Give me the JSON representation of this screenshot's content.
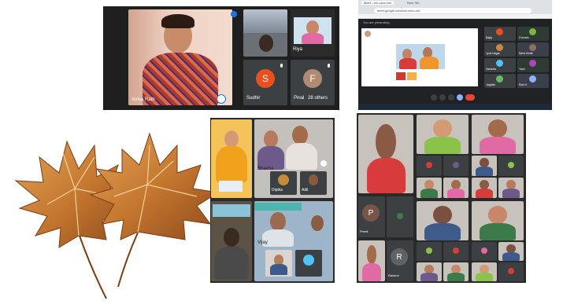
{
  "panel1": {
    "presenter_name": "Amsa Rath",
    "tiles": [
      {
        "name": "Riya"
      },
      {
        "name": "Sudhir",
        "initial": "S",
        "color": "#e8501f"
      },
      {
        "name": "Pinal",
        "initial": "F",
        "color": "#b08a73"
      },
      {
        "name": "28 others"
      }
    ]
  },
  "panel2": {
    "tab1": "Meet - xxx-xxxx-xxx",
    "tab2": "New Tab",
    "url": "meet.google.com/xxx-xxxx-xxx",
    "participants": [
      "Bajaj",
      "Gurnam",
      "Jyoti Nagar",
      "Neha Bhatt",
      "Harshita",
      "Yash",
      "Jagdish",
      "Ravi K"
    ],
    "presenting_label": "You are presenting",
    "colors": {
      "end_call": "#ea4335",
      "present": "#8ab4f8"
    }
  },
  "panel3": {
    "tiles": [
      "Bhavna",
      "Dipika",
      "Adil",
      "Vijay",
      "Sunil",
      "Abhay"
    ]
  },
  "panel4": {
    "initials": [
      "P",
      "R"
    ],
    "names": [
      "Preeti",
      "Rashmi"
    ],
    "colors": {
      "p": "#795548",
      "r": "#5f6368"
    }
  },
  "decor": {
    "leaf_color": "#c6782f"
  }
}
